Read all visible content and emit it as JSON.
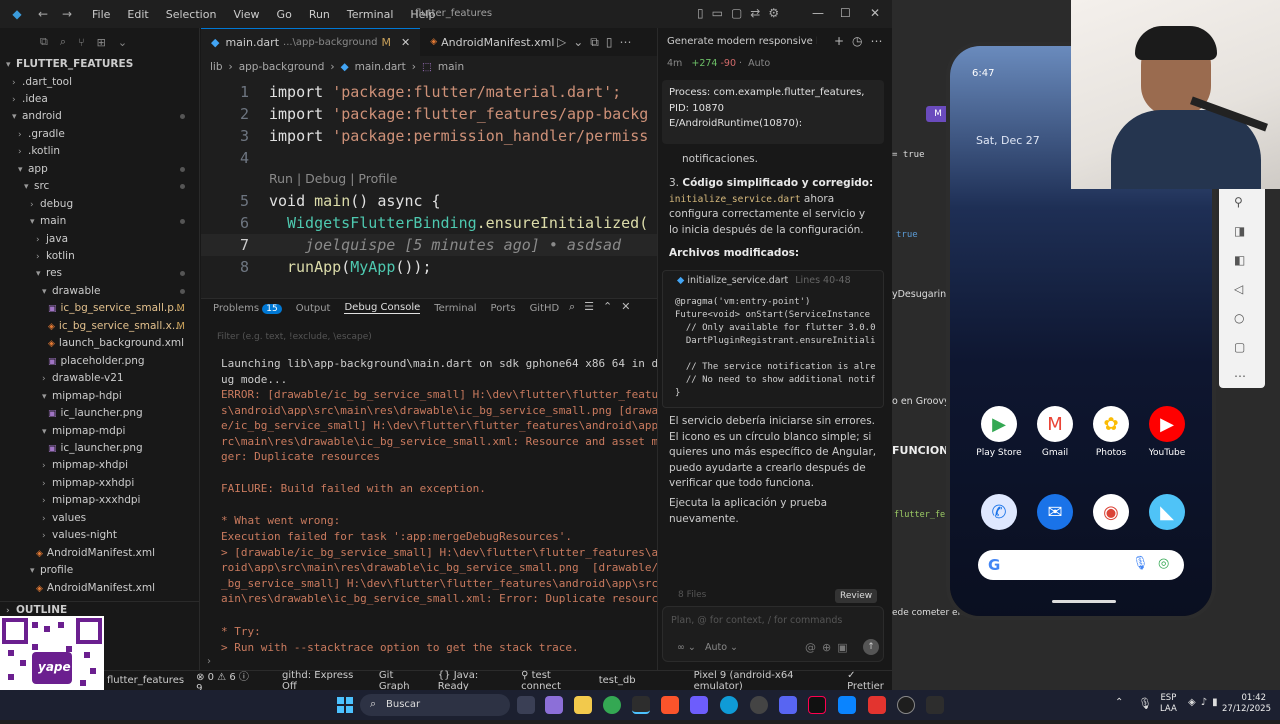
{
  "window_title": "flutter_features",
  "menu": [
    "File",
    "Edit",
    "Selection",
    "View",
    "Go",
    "Run",
    "Terminal",
    "Help"
  ],
  "explorer": {
    "root": "FLUTTER_FEATURES",
    "items": [
      {
        "label": ".dart_tool",
        "depth": 1,
        "type": "folder",
        "open": false
      },
      {
        "label": ".idea",
        "depth": 1,
        "type": "folder",
        "open": false
      },
      {
        "label": "android",
        "depth": 1,
        "type": "folder",
        "open": true,
        "dot": true
      },
      {
        "label": ".gradle",
        "depth": 2,
        "type": "folder",
        "open": false
      },
      {
        "label": ".kotlin",
        "depth": 2,
        "type": "folder",
        "open": false
      },
      {
        "label": "app",
        "depth": 2,
        "type": "folder",
        "open": true,
        "dot": true
      },
      {
        "label": "src",
        "depth": 3,
        "type": "folder",
        "open": true,
        "dot": true
      },
      {
        "label": "debug",
        "depth": 4,
        "type": "folder",
        "open": false
      },
      {
        "label": "main",
        "depth": 4,
        "type": "folder",
        "open": true,
        "dot": true
      },
      {
        "label": "java",
        "depth": 5,
        "type": "folder",
        "open": false
      },
      {
        "label": "kotlin",
        "depth": 5,
        "type": "folder",
        "open": false
      },
      {
        "label": "res",
        "depth": 5,
        "type": "folder",
        "open": true,
        "dot": true
      },
      {
        "label": "drawable",
        "depth": 6,
        "type": "folder",
        "open": true,
        "dot": true
      },
      {
        "label": "ic_bg_service_small.p...",
        "depth": 7,
        "type": "png",
        "mark": "M"
      },
      {
        "label": "ic_bg_service_small.x...",
        "depth": 7,
        "type": "xml",
        "mark": "M"
      },
      {
        "label": "launch_background.xml",
        "depth": 7,
        "type": "xml"
      },
      {
        "label": "placeholder.png",
        "depth": 7,
        "type": "png"
      },
      {
        "label": "drawable-v21",
        "depth": 6,
        "type": "folder",
        "open": false
      },
      {
        "label": "mipmap-hdpi",
        "depth": 6,
        "type": "folder",
        "open": true
      },
      {
        "label": "ic_launcher.png",
        "depth": 7,
        "type": "png"
      },
      {
        "label": "mipmap-mdpi",
        "depth": 6,
        "type": "folder",
        "open": true
      },
      {
        "label": "ic_launcher.png",
        "depth": 7,
        "type": "png"
      },
      {
        "label": "mipmap-xhdpi",
        "depth": 6,
        "type": "folder",
        "open": false
      },
      {
        "label": "mipmap-xxhdpi",
        "depth": 6,
        "type": "folder",
        "open": false
      },
      {
        "label": "mipmap-xxxhdpi",
        "depth": 6,
        "type": "folder",
        "open": false
      },
      {
        "label": "values",
        "depth": 6,
        "type": "folder",
        "open": false
      },
      {
        "label": "values-night",
        "depth": 6,
        "type": "folder",
        "open": false
      },
      {
        "label": "AndroidManifest.xml",
        "depth": 5,
        "type": "xml"
      },
      {
        "label": "profile",
        "depth": 4,
        "type": "folder",
        "open": true
      },
      {
        "label": "AndroidManifest.xml",
        "depth": 5,
        "type": "xml"
      }
    ],
    "outline": "OUTLINE"
  },
  "editor": {
    "tabs": [
      {
        "label": "main.dart",
        "detail": "...\\app-background",
        "mark": "M",
        "active": true
      },
      {
        "label": "AndroidManifest.xml",
        "active": false
      }
    ],
    "breadcrumb": [
      "lib",
      "app-background",
      "main.dart",
      "main"
    ],
    "codelens": "Run | Debug | Profile",
    "lines": [
      {
        "n": "1",
        "kw": "import ",
        "str": "'package:flutter/material.dart';"
      },
      {
        "n": "2",
        "kw": "import ",
        "str": "'package:flutter_features/app-backg"
      },
      {
        "n": "3",
        "kw": "import ",
        "str": "'package:permission_handler/permiss"
      },
      {
        "n": "4",
        "kw": "",
        "str": ""
      }
    ],
    "main_sig": {
      "n": "5",
      "type": "void ",
      "fn": "main",
      "rest": "() async {"
    },
    "line6": {
      "n": "6",
      "cls": "WidgetsFlutterBinding",
      "rest": ".ensureInitialized("
    },
    "line7": {
      "n": "7",
      "blame": "joelquispe [5 minutes ago] • asdsad"
    },
    "line8": {
      "n": "8",
      "fn": "runApp",
      "p1": "(",
      "cls": "MyApp",
      "p2": "());"
    }
  },
  "panel": {
    "tabs": [
      "Problems",
      "Output",
      "Debug Console",
      "Terminal",
      "Ports",
      "GitHD"
    ],
    "problems_count": "15",
    "filter_placeholder": "Filter (e.g. text, !exclude, \\escape)",
    "console": [
      {
        "text": "Launching lib\\app-background\\main.dart on sdk gphone64 x86 64 in deb\nug mode...",
        "kind": "info"
      },
      {
        "text": "ERROR: [drawable/ic_bg_service_small] H:\\dev\\flutter\\flutter_feature\ns\\android\\app\\src\\main\\res\\drawable\\ic_bg_service_small.png [drawabl\ne/ic_bg_service_small] H:\\dev\\flutter\\flutter_features\\android\\app\\s\nrc\\main\\res\\drawable\\ic_bg_service_small.xml: Resource and asset mer\nger: Duplicate resources",
        "kind": "err"
      },
      {
        "text": "FAILURE: Build failed with an exception.",
        "kind": "err"
      },
      {
        "text": "* What went wrong:",
        "kind": "err"
      },
      {
        "text": "Execution failed for task ':app:mergeDebugResources'.\n> [drawable/ic_bg_service_small] H:\\dev\\flutter\\flutter_features\\and\nroid\\app\\src\\main\\res\\drawable\\ic_bg_service_small.png  [drawable/ic\n_bg_service_small] H:\\dev\\flutter\\flutter_features\\android\\app\\src\\m\nain\\res\\drawable\\ic_bg_service_small.xml: Error: Duplicate resources",
        "kind": "err"
      },
      {
        "text": "* Try:\n> Run with --stacktrace option to get the stack trace.",
        "kind": "err"
      }
    ]
  },
  "chat": {
    "title": "Generate modern responsive logi",
    "meta_time": "4m",
    "meta_added": "+274",
    "meta_removed": "-90",
    "meta_mode": "Auto",
    "process_text": "Process: com.example.flutter_features,\nPID: 10870\nE/AndroidRuntime(10870):",
    "notif": "notificaciones.",
    "item3_bold": "Código simplificado y corregido:",
    "item3_code": "initialize_service.dart",
    "item3_rest": "ahora configura correctamente el servicio y lo inicia después de la configuración.",
    "files_heading": "Archivos modificados:",
    "file_name": "initialize_service.dart",
    "file_lines": "Lines 40-48",
    "code": "@pragma('vm:entry-point')\nFuture<void> onStart(ServiceInstance\n  // Only available for flutter 3.0.0\n  DartPluginRegistrant.ensureInitiali\n\n  // The service notification is alre\n  // No need to show additional notif\n}",
    "para1": "El servicio debería iniciarse sin errores. El icono es un círculo blanco simple; si quieres uno más específico de Angular, puedo ayudarte a crearlo después de verificar que todo funciona.",
    "para2": "Ejecuta la aplicación y prueba nuevamente.",
    "files_count": "8 Files",
    "review": "Review",
    "input_placeholder": "Plan, @ for context, / for commands",
    "mode": "Auto"
  },
  "statusbar": {
    "branch": "flutter_features",
    "errors": "0",
    "warnings": "6",
    "infos": "9",
    "githd": "githd: Express Off",
    "gitgraph": "Git Graph",
    "java": "Java: Ready",
    "test_connect": "test connect",
    "test_db": "test_db",
    "device": "Pixel 9 (android-x64 emulator)",
    "prettier": "Prettier"
  },
  "background_app": {
    "badge": "M",
    "code_true_1": "= true",
    "code_true_2": "true",
    "fn_name": "yDesugarin",
    "groovy": "o en Groovy.",
    "funciona": "FUNCIONA",
    "feat": "flutter_fe",
    "cometer": "ede cometer errores."
  },
  "phone": {
    "time": "6:47",
    "date": "Sat, Dec 27",
    "apps_row1": [
      {
        "label": "Play Store",
        "icon": "play-store-icon",
        "color": "#ffffff"
      },
      {
        "label": "Gmail",
        "icon": "gmail-icon",
        "color": "#ffffff"
      },
      {
        "label": "Photos",
        "icon": "photos-icon",
        "color": "#ffffff"
      },
      {
        "label": "YouTube",
        "icon": "youtube-icon",
        "color": "#ff0000"
      }
    ],
    "dock": [
      {
        "icon": "phone-icon",
        "color": "#dfe8ff"
      },
      {
        "icon": "messages-icon",
        "color": "#1a73e8"
      },
      {
        "icon": "chrome-icon",
        "color": "#ffffff"
      },
      {
        "icon": "flutter-app-icon",
        "color": "#4fc3f7"
      }
    ],
    "search_g": "G"
  },
  "taskbar": {
    "search_label": "Buscar",
    "lang": "ESP",
    "lang2": "LAA",
    "time": "01:42",
    "date": "27/12/2025"
  },
  "qr_brand": "yape"
}
